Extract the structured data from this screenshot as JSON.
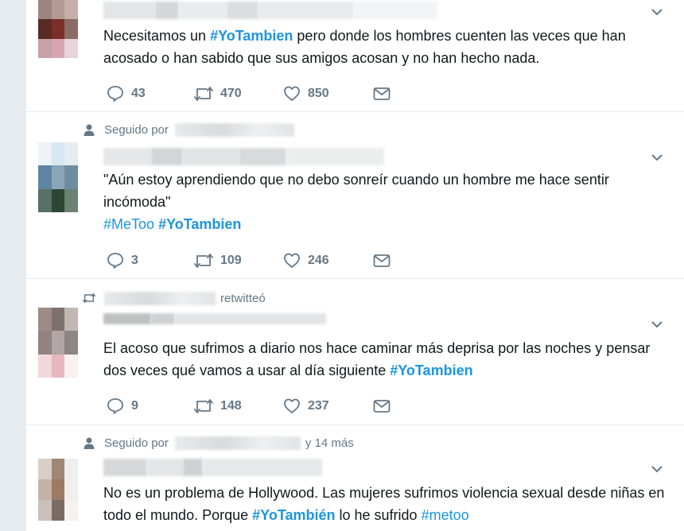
{
  "tweets": [
    {
      "text_before": "Necesitamos un ",
      "hashtag1": "#YoTambien",
      "text_after": " pero donde los hombres cuenten las veces que han acosado o han sabido que sus amigos acosan y no han hecho nada.",
      "replies": "43",
      "retweets": "470",
      "likes": "850"
    },
    {
      "context": "Seguido por",
      "text": "\"Aún estoy aprendiendo que no debo sonreír cuando un hombre me hace sentir incómoda\"",
      "hashtag1": "#MeToo",
      "hashtag2": "#YoTambien",
      "replies": "3",
      "retweets": "109",
      "likes": "246"
    },
    {
      "context": "retwitteó",
      "text": "El acoso que sufrimos a diario nos hace caminar más deprisa por las noches y pensar dos veces qué vamos a usar al día siguiente ",
      "hashtag1": "#YoTambien",
      "replies": "9",
      "retweets": "148",
      "likes": "237"
    },
    {
      "context": "Seguido por",
      "context_suffix": "y 14 más",
      "text_before": "No es un problema de Hollywood. Las mujeres sufrimos violencia sexual desde niñas en todo el mundo. Porque ",
      "hashtag1": "#YoTambién",
      "text_mid": " lo he sufrido ",
      "hashtag2": "#metoo"
    }
  ],
  "colors": {
    "link": "#1b95e0",
    "muted": "#657786",
    "text": "#14171a",
    "border": "#e6ecf0"
  },
  "icons": [
    "reply-icon",
    "retweet-icon",
    "like-icon",
    "message-icon",
    "chevron-down-icon",
    "person-icon"
  ]
}
